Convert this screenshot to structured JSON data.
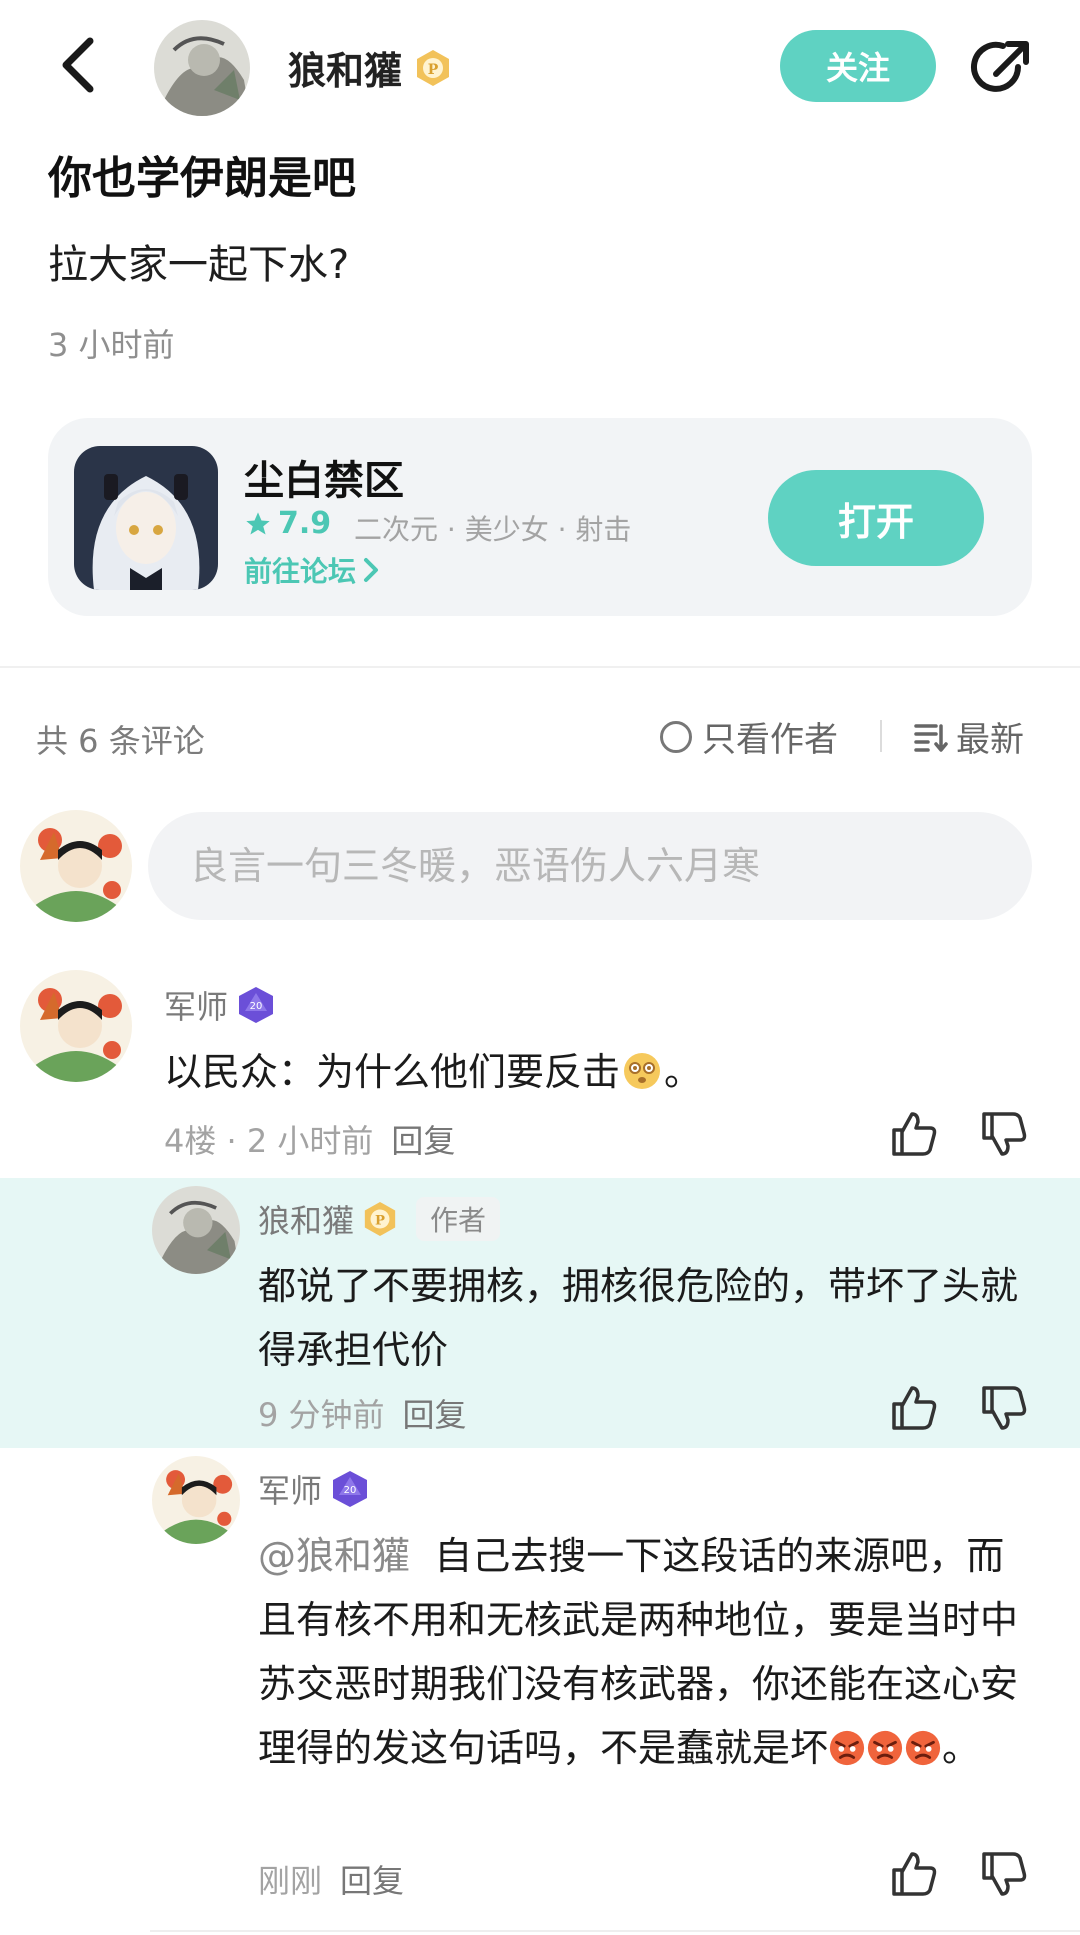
{
  "header": {
    "author_name": "狼和獾",
    "follow_label": "关注"
  },
  "post": {
    "title": "你也学伊朗是吧",
    "body": "拉大家一起下水?",
    "time": "3 小时前"
  },
  "game_card": {
    "name": "尘白禁区",
    "rating": "7.9",
    "tags": "二次元 · 美少女 · 射击",
    "forum_link": "前往论坛",
    "open_label": "打开"
  },
  "comments_bar": {
    "count_label": "共 6 条评论",
    "author_only_label": "只看作者",
    "sort_label": "最新"
  },
  "comment_input": {
    "placeholder": "良言一句三冬暖，恶语伤人六月寒"
  },
  "comments": [
    {
      "user": "军师",
      "text": "以民众：为什么他们要反击",
      "text_suffix": "。",
      "meta": "4楼 · 2 小时前",
      "reply_label": "回复"
    },
    {
      "user": "狼和獾",
      "author_tag": "作者",
      "text": "都说了不要拥核，拥核很危险的，带坏了头就得承担代价",
      "meta": "9 分钟前",
      "reply_label": "回复"
    },
    {
      "user": "军师",
      "mention": "@狼和獾",
      "text": "自己去搜一下这段话的来源吧，而且有核不用和无核武是两种地位，要是当时中苏交恶时期我们没有核武器，你还能在这心安理得的发这句话吗，不是蠢就是坏",
      "text_suffix": "。",
      "meta": "刚刚",
      "reply_label": "回复"
    }
  ],
  "colors": {
    "accent": "#5fd2c2",
    "accent_text": "#4cc7b4",
    "highlight_bg": "#e6f7f5",
    "gold_badge": "#f0b94a",
    "purple_badge": "#6b4fd8"
  },
  "icons": [
    "back-arrow-icon",
    "verified-gold-icon",
    "share-icon",
    "star-icon",
    "chevron-right-icon",
    "radio-circle-icon",
    "sort-lines-icon",
    "dice-badge-icon",
    "thumbs-up-icon",
    "thumbs-down-icon",
    "emoji-dizzy-icon",
    "emoji-angry-icon"
  ]
}
